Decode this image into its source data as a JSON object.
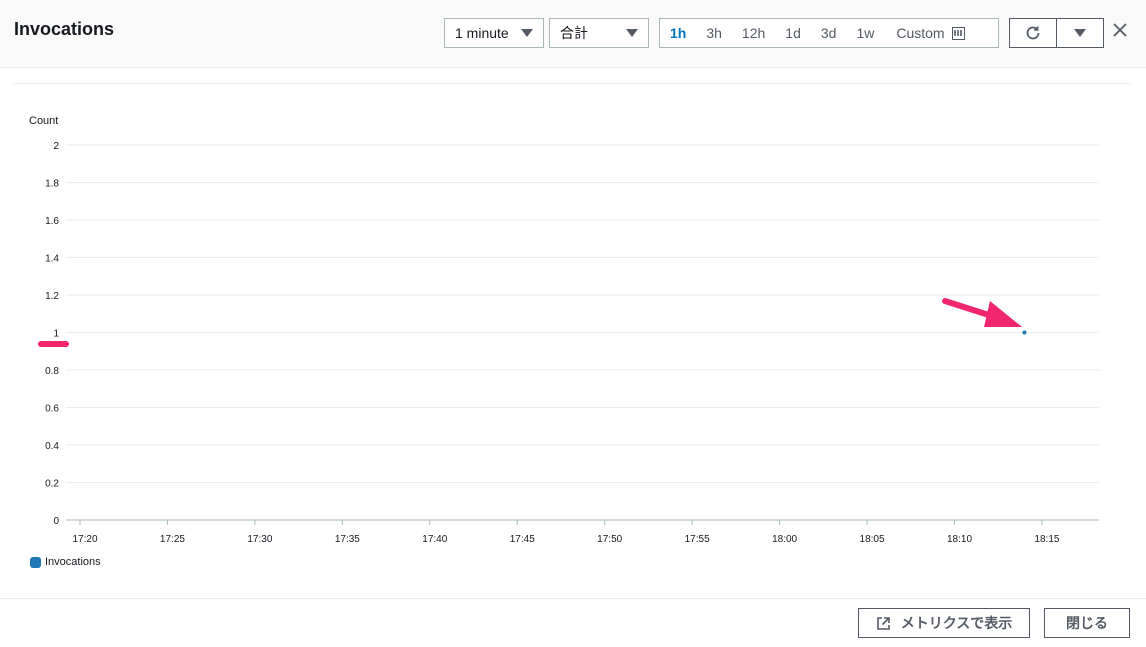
{
  "header": {
    "title": "Invocations",
    "period": "1 minute",
    "statistic": "合計",
    "ranges": [
      "1h",
      "3h",
      "12h",
      "1d",
      "3d",
      "1w"
    ],
    "custom_label": "Custom"
  },
  "icons": {
    "refresh": "refresh-icon",
    "close": "close-icon",
    "calendar": "calendar-icon",
    "external": "external-link-icon"
  },
  "colors": {
    "series": "#1f77b4",
    "active_range": "#0073bb",
    "annotation": "#f0266e"
  },
  "chart_data": {
    "type": "line",
    "ylabel": "Count",
    "ylim": [
      0,
      2
    ],
    "yticks": [
      "0",
      "0.2",
      "0.4",
      "0.6",
      "0.8",
      "1",
      "1.2",
      "1.4",
      "1.6",
      "1.8",
      "2"
    ],
    "xticks": [
      "17:20",
      "17:25",
      "17:30",
      "17:35",
      "17:40",
      "17:45",
      "17:50",
      "17:55",
      "18:00",
      "18:05",
      "18:10",
      "18:15"
    ],
    "series": [
      {
        "name": "Invocations",
        "points": [
          {
            "x": "18:14",
            "y": 1
          }
        ]
      }
    ],
    "grid": true,
    "legend_position": "bottom-left"
  },
  "footer": {
    "view_metrics": "メトリクスで表示",
    "close": "閉じる"
  }
}
